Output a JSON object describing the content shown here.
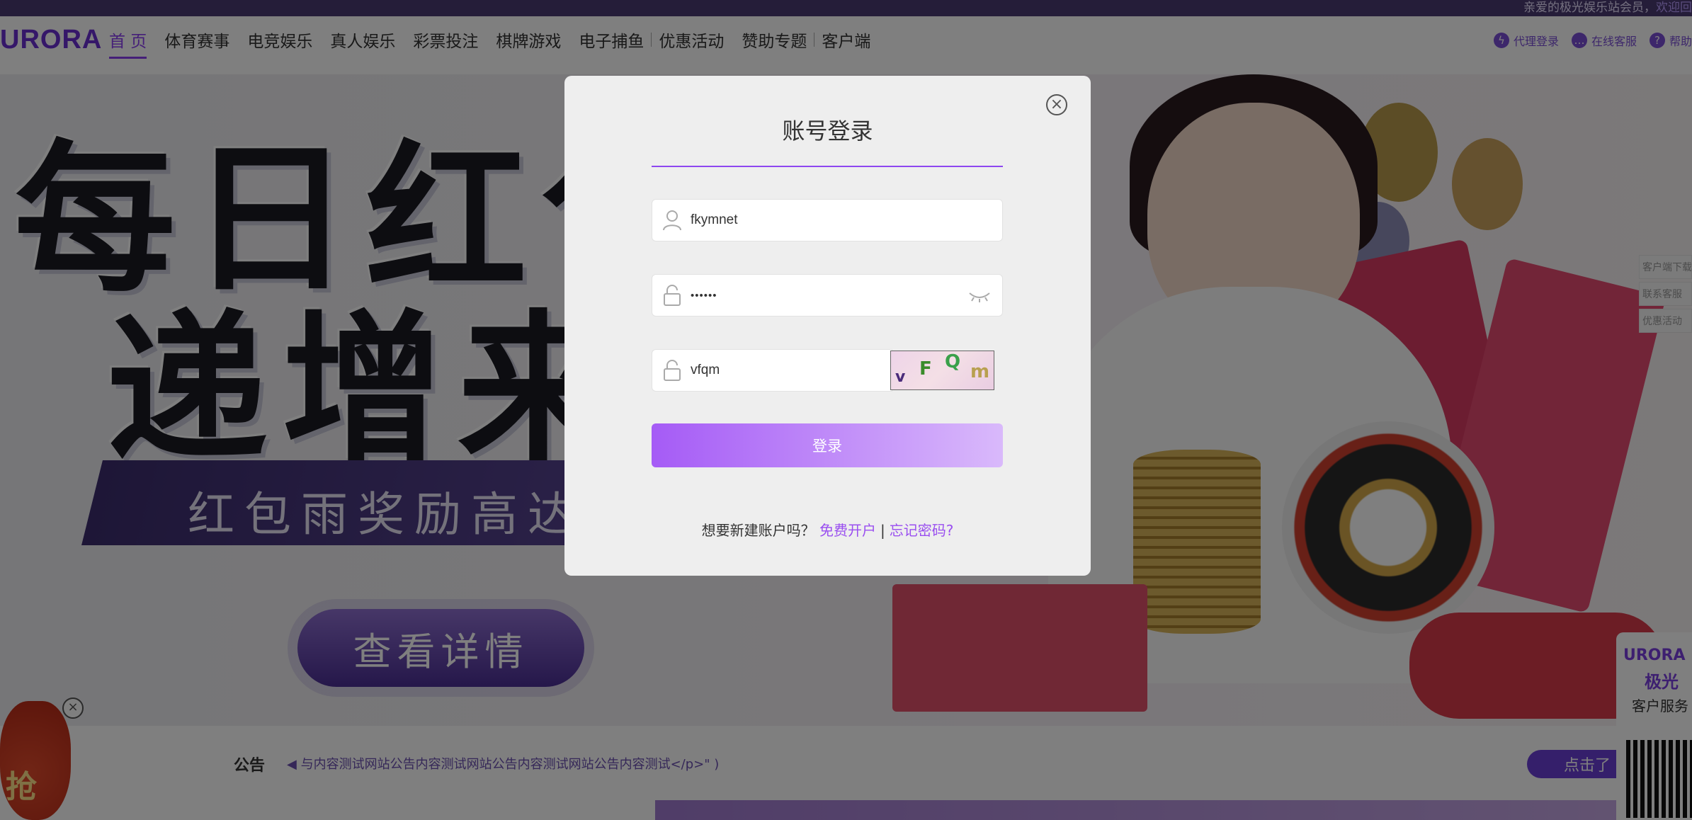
{
  "topbar": {
    "welcome_prefix": "亲爱的极光娱乐站会员，",
    "welcome_link": "欢迎回"
  },
  "nav": {
    "logo": "URORA",
    "items": [
      {
        "label": "首 页",
        "active": true
      },
      {
        "label": "体育赛事"
      },
      {
        "label": "电竞娱乐"
      },
      {
        "label": "真人娱乐"
      },
      {
        "label": "彩票投注"
      },
      {
        "label": "棋牌游戏"
      },
      {
        "label": "电子捕鱼"
      },
      {
        "label": "优惠活动"
      },
      {
        "label": "赞助专题"
      },
      {
        "label": "客户端"
      }
    ],
    "right_links": [
      {
        "label": "代理登录",
        "icon": "lightning-icon"
      },
      {
        "label": "在线客服",
        "icon": "chat-icon"
      },
      {
        "label": "帮助",
        "icon": "help-icon"
      }
    ]
  },
  "banner": {
    "title_line1": "每日红包",
    "title_line2": "递增来",
    "subtitle": "红包雨奖励高达1",
    "cta": "查看详情"
  },
  "side_tabs": [
    "客户端下载",
    "联系客服",
    "优惠活动"
  ],
  "notice": {
    "label": "公告",
    "text": "与内容测试网站公告内容测试网站公告内容测试网站公告内容测试</p>\" )",
    "more": "点击了"
  },
  "redbag": {
    "label": "抢"
  },
  "qr_card": {
    "brand": "URORA",
    "brand_cn": "极光",
    "service": "客户服务"
  },
  "login_modal": {
    "title": "账号登录",
    "username": {
      "value": "fkymnet"
    },
    "password": {
      "value": "••••••"
    },
    "captcha": {
      "value": "vfqm",
      "image_text": [
        "v",
        "F",
        "Q",
        "m"
      ]
    },
    "submit": "登录",
    "footer": {
      "prompt": "想要新建账户吗？",
      "register": "免费开户",
      "separator": "|",
      "forgot": "忘记密码?"
    }
  },
  "colors": {
    "accent": "#8e47f0",
    "button_start": "#a55bf6",
    "button_end": "#d9b9fb",
    "nav_dark": "#4b3b73"
  }
}
